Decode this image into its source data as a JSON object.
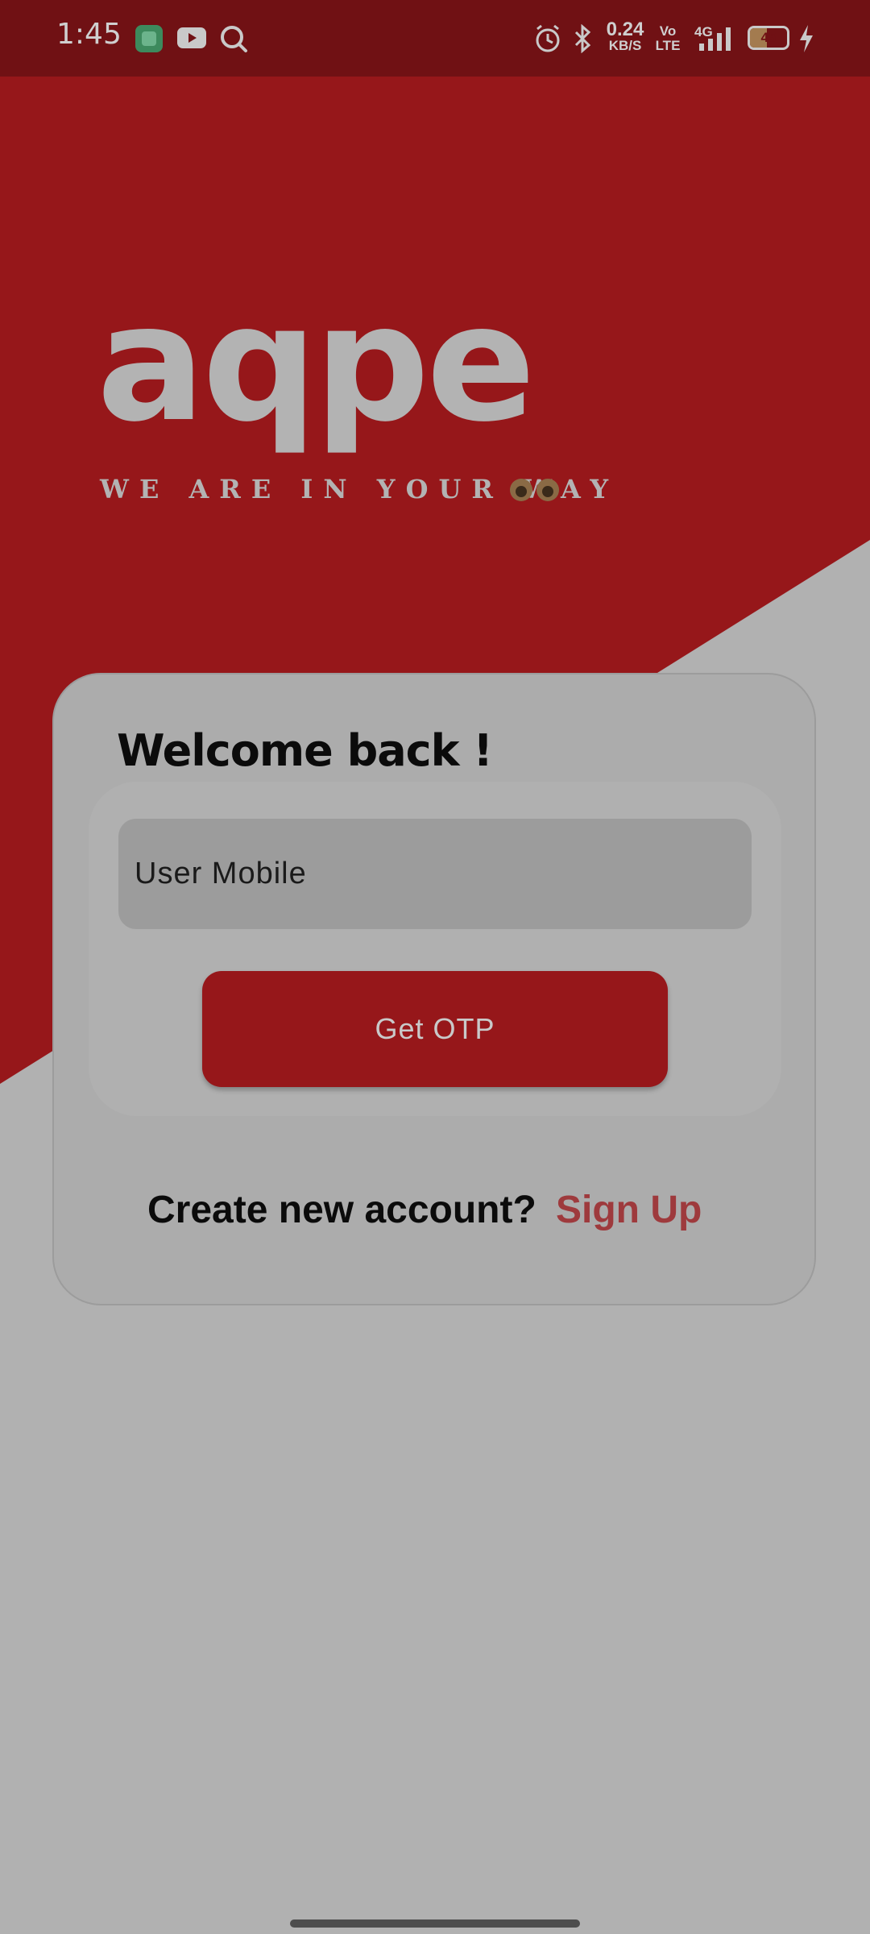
{
  "status_bar": {
    "time": "1:45",
    "net_speed_value": "0.24",
    "net_speed_unit": "KB/S",
    "volte_top": "Vo",
    "volte_bottom": "LTE",
    "network": "4G",
    "battery": "45",
    "icons": [
      "app-notification-icon",
      "youtube-icon",
      "search-icon",
      "alarm-icon",
      "bluetooth-icon",
      "signal-icon",
      "battery-icon",
      "charging-icon"
    ]
  },
  "brand": {
    "logo_text": "aqpe",
    "tagline": "WE ARE IN YOUR WAY"
  },
  "login": {
    "title": "Welcome back !",
    "mobile_placeholder": "User Mobile",
    "otp_button": "Get OTP",
    "create_prompt": "Create new account?",
    "signup_link": "Sign Up"
  },
  "colors": {
    "primary_red": "#96171a",
    "status_bar": "#701114",
    "background": "#b1b1b1",
    "link": "#9e3a3d"
  }
}
